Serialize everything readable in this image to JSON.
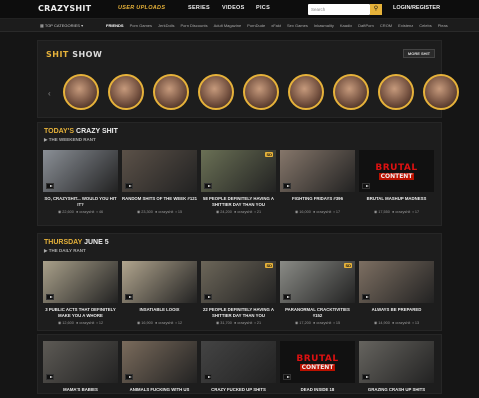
{
  "header": {
    "logo": "CRAZYSHIT",
    "nav": [
      "USER UPLOADS",
      "SERIES",
      "VIDEOS",
      "PICS"
    ],
    "search_placeholder": "Search",
    "login": "LOGIN/REGISTER"
  },
  "subnav": {
    "categories": "TOP CATEGORIES",
    "items": [
      "FRIENDS",
      "Porn Games",
      "JerkDolls",
      "Porn Discounts",
      "Adult Magazine",
      "PornDude",
      "xFakt",
      "Sex Games",
      "Inkasmality",
      "Kaadix",
      "DaftPorn",
      "CROM",
      "Existenz",
      "Celebs",
      "Pleas"
    ]
  },
  "shit_show": {
    "title_a": "SHIT",
    "title_b": "SHOW",
    "more": "MORE SHIT",
    "prev_icon": "chevron-left",
    "next_icon": "chevron-right",
    "accent": "#e6b23a"
  },
  "sections": [
    {
      "title_a": "TODAY'S",
      "title_b": "CRAZY SHIT",
      "subtitle": "THE WEEKEND RANT",
      "cards": [
        {
          "title": "SO, CRAZYSHIT... WOULD YOU HIT IT?",
          "views": "22,600",
          "user": "crazyshit",
          "comments": "46",
          "badge": "",
          "brutal": false
        },
        {
          "title": "RANDOM SHITS OF THE WEEK #121",
          "views": "23,300",
          "user": "crazyshit",
          "comments": "15",
          "badge": "",
          "brutal": false
        },
        {
          "title": "58 PEOPLE DEFINITELY HAVING A SHITTIER DAY THAN YOU",
          "views": "24,200",
          "user": "crazyshit",
          "comments": "21",
          "badge": "SD",
          "brutal": false
        },
        {
          "title": "FIGHTING FRIDAYS #396",
          "views": "16,000",
          "user": "crazyshit",
          "comments": "17",
          "badge": "",
          "brutal": false
        },
        {
          "title": "BRUTAL MASHUP MADNESS",
          "views": "17,550",
          "user": "crazyshit",
          "comments": "17",
          "badge": "",
          "brutal": true
        }
      ]
    },
    {
      "title_a": "THURSDAY",
      "title_b": "JUNE 5",
      "subtitle": "THE DAILY RANT",
      "cards": [
        {
          "title": "3 PUBLIC ACTS THAT DEFINITELY MAKE YOU A WHORE",
          "views": "12,600",
          "user": "crazyshit",
          "comments": "12",
          "badge": "",
          "brutal": false
        },
        {
          "title": "INSATIABLE LOOIX",
          "views": "16,900",
          "user": "crazyshit",
          "comments": "12",
          "badge": "",
          "brutal": false
        },
        {
          "title": "22 PEOPLE DEFINITELY HAVING A SHITTIER DAY THAN YOU",
          "views": "31,700",
          "user": "crazyshit",
          "comments": "21",
          "badge": "SD",
          "brutal": false
        },
        {
          "title": "PARANORMAL CRACKTIVITIES #152",
          "views": "17,200",
          "user": "crazyshit",
          "comments": "15",
          "badge": "SD",
          "brutal": false
        },
        {
          "title": "ALWAYS BE PREPARED",
          "views": "14,900",
          "user": "crazyshit",
          "comments": "13",
          "badge": "",
          "brutal": false
        }
      ]
    },
    {
      "title_a": "",
      "title_b": "",
      "subtitle": "",
      "cards": [
        {
          "title": "MAMA'S BABIES",
          "views": "",
          "user": "",
          "comments": "",
          "badge": "",
          "brutal": false
        },
        {
          "title": "ANIMALS FUCKING WITH US",
          "views": "",
          "user": "",
          "comments": "",
          "badge": "",
          "brutal": false
        },
        {
          "title": "CRAZY FUCKED UP SHITS",
          "views": "",
          "user": "",
          "comments": "",
          "badge": "",
          "brutal": false
        },
        {
          "title": "DEAD INSIDE 18",
          "views": "",
          "user": "",
          "comments": "",
          "badge": "",
          "brutal": true
        },
        {
          "title": "GRAZING CRASH UP SHITS",
          "views": "",
          "user": "",
          "comments": "",
          "badge": "",
          "brutal": false
        }
      ]
    }
  ]
}
